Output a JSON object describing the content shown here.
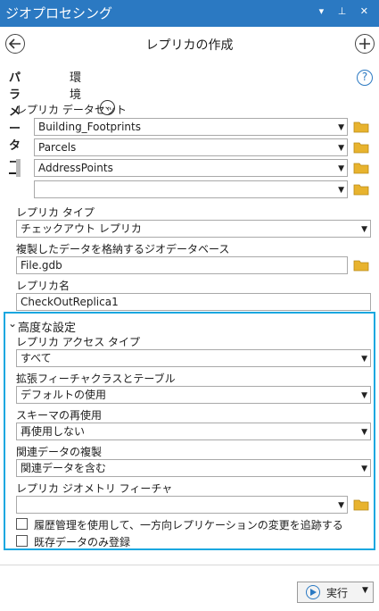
{
  "window": {
    "title": "ジオプロセシング",
    "controls": "▾ ⊥ ✕"
  },
  "tool": {
    "title": "レプリカの作成",
    "back_icon": "arrow-left-icon",
    "add_icon": "plus-circle-icon"
  },
  "tabs": [
    {
      "label": "パラメーター"
    },
    {
      "label": "環境"
    }
  ],
  "help_glyph": "?",
  "params": {
    "dataset_label": "レプリカ データセット",
    "datasets": [
      {
        "value": "Building_Footprints"
      },
      {
        "value": "Parcels"
      },
      {
        "value": "AddressPoints"
      },
      {
        "value": ""
      }
    ],
    "type_label": "レプリカ タイプ",
    "type_value": "チェックアウト レプリカ",
    "gdb_label": "複製したデータを格納するジオデータベース",
    "gdb_value": "File.gdb",
    "name_label": "レプリカ名",
    "name_value": "CheckOutReplica1"
  },
  "advanced": {
    "header": "高度な設定",
    "access_label": "レプリカ アクセス タイプ",
    "access_value": "すべて",
    "ext_label": "拡張フィーチャクラスとテーブル",
    "ext_value": "デフォルトの使用",
    "schema_label": "スキーマの再使用",
    "schema_value": "再使用しない",
    "related_label": "関連データの複製",
    "related_value": "関連データを含む",
    "geom_label": "レプリカ ジオメトリ フィーチャ",
    "geom_value": "",
    "check1": "履歴管理を使用して、一方向レプリケーションの変更を追跡する",
    "check2": "既存データのみ登録"
  },
  "run": {
    "label": "実行"
  },
  "colors": {
    "titlebar": "#2b79c2",
    "highlight": "#1aa7e0",
    "folder": "#e8b32e"
  }
}
